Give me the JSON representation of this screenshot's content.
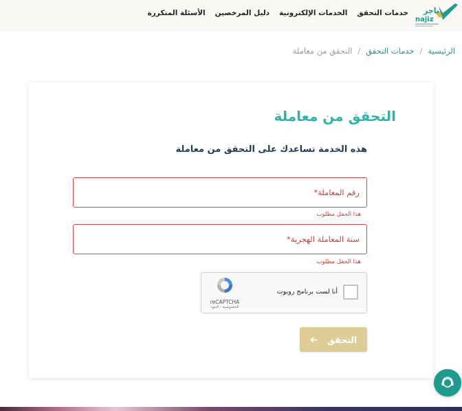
{
  "header": {
    "logo_text": "ناجز najiz",
    "nav": [
      {
        "label": "خدمات التحقق"
      },
      {
        "label": "الخدمات الإلكترونية"
      },
      {
        "label": "دليل المرخصين"
      },
      {
        "label": "الأسئلة المتكررة"
      }
    ]
  },
  "breadcrumb": {
    "home": "الرئيسية",
    "section": "خدمات التحقق",
    "current": "التحقق من معاملة",
    "separator": "/"
  },
  "form": {
    "title": "التحقق من معاملة",
    "subtitle": "هذه الخدمة تساعدك على التحقق من معاملة",
    "fields": [
      {
        "label": "رقم المعاملة",
        "required_mark": "*",
        "error": "هذا الحقل مطلوب"
      },
      {
        "label": "سنة المعاملة الهجرية",
        "required_mark": "*",
        "error": "هذا الحقل مطلوب"
      }
    ],
    "captcha": {
      "checkbox_label": "أنا لست برنامج روبوت",
      "brand": "reCAPTCHA",
      "terms": "الخصوصية - البنود"
    },
    "submit": {
      "label": "التحقق",
      "icon": "arrow-left-icon"
    }
  },
  "colors": {
    "primary": "#2cb5a8",
    "accent_gold": "#dfcd97",
    "error": "#d33a3a",
    "heading": "#1f3d57"
  }
}
